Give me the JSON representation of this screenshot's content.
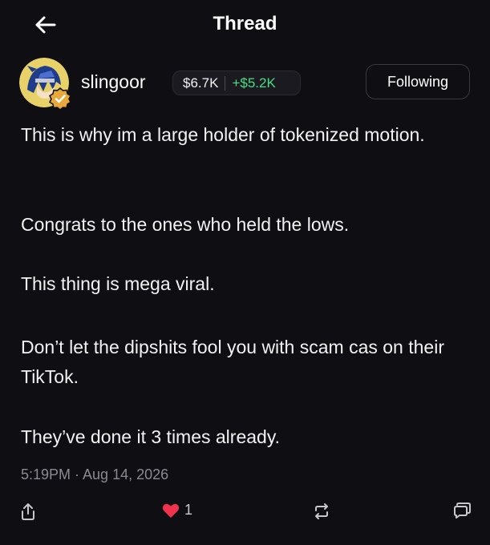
{
  "header": {
    "title": "Thread",
    "back_icon": "arrow-left-icon"
  },
  "author": {
    "username": "slingoor",
    "verified_icon": "verified-check-icon",
    "holdings_value": "$6.7K",
    "holdings_change": "+$5.2K",
    "follow_label": "Following"
  },
  "post": {
    "paragraphs": [
      "This is why im a large holder of tokenized motion.",
      "Congrats to the ones who held the lows.",
      "This thing is mega viral.",
      "Don’t let the dipshits fool you with scam cas on their TikTok.",
      "They’ve done it 3 times already."
    ],
    "timestamp": "5:19PM · Aug 14, 2026"
  },
  "actions": {
    "share_icon": "share-icon",
    "like_icon": "heart-icon",
    "like_count": "1",
    "repost_icon": "repost-icon",
    "reply_icon": "reply-icon"
  },
  "colors": {
    "background": "#0f0e12",
    "positive": "#4ade80",
    "like": "#f0324d",
    "muted": "#8a8a92"
  }
}
